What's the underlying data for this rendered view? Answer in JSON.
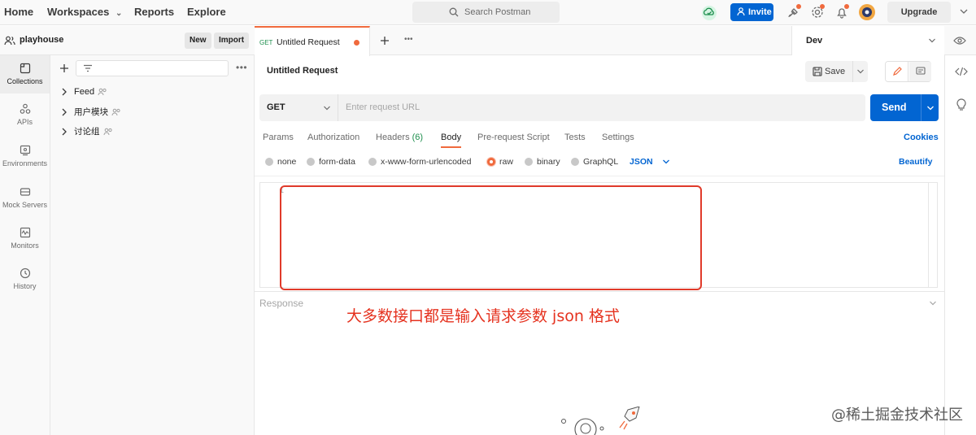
{
  "topbar": {
    "nav": [
      "Home",
      "Workspaces",
      "Reports",
      "Explore"
    ],
    "search_placeholder": "Search Postman",
    "invite_label": "Invite",
    "upgrade_label": "Upgrade"
  },
  "workspace": {
    "name": "playhouse",
    "new_label": "New",
    "import_label": "Import"
  },
  "leftnav": [
    {
      "label": "Collections",
      "icon": "collections-icon"
    },
    {
      "label": "APIs",
      "icon": "apis-icon"
    },
    {
      "label": "Environments",
      "icon": "environments-icon"
    },
    {
      "label": "Mock Servers",
      "icon": "mock-servers-icon"
    },
    {
      "label": "Monitors",
      "icon": "monitors-icon"
    },
    {
      "label": "History",
      "icon": "history-icon"
    }
  ],
  "collections": [
    {
      "name": "Feed"
    },
    {
      "name": "用户模块"
    },
    {
      "name": "讨论组"
    }
  ],
  "tab": {
    "method": "GET",
    "title": "Untitled Request"
  },
  "environment": "Dev",
  "request": {
    "title": "Untitled Request",
    "save_label": "Save",
    "method": "GET",
    "url_placeholder": "Enter request URL",
    "send_label": "Send"
  },
  "request_tabs": {
    "params": "Params",
    "authorization": "Authorization",
    "headers": "Headers",
    "headers_count": "(6)",
    "body": "Body",
    "prerequest": "Pre-request Script",
    "tests": "Tests",
    "settings": "Settings",
    "cookies": "Cookies"
  },
  "body_options": {
    "none": "none",
    "form_data": "form-data",
    "urlencoded": "x-www-form-urlencoded",
    "raw": "raw",
    "binary": "binary",
    "graphql": "GraphQL",
    "format": "JSON",
    "beautify": "Beautify"
  },
  "editor_line": "1",
  "response_label": "Response",
  "annotation": "大多数接口都是输入请求参数 json 格式",
  "watermark": "@稀土掘金技术社区",
  "colors": {
    "accent": "#f06a3d",
    "primary": "#0265d2",
    "annotation": "#e5321f"
  }
}
